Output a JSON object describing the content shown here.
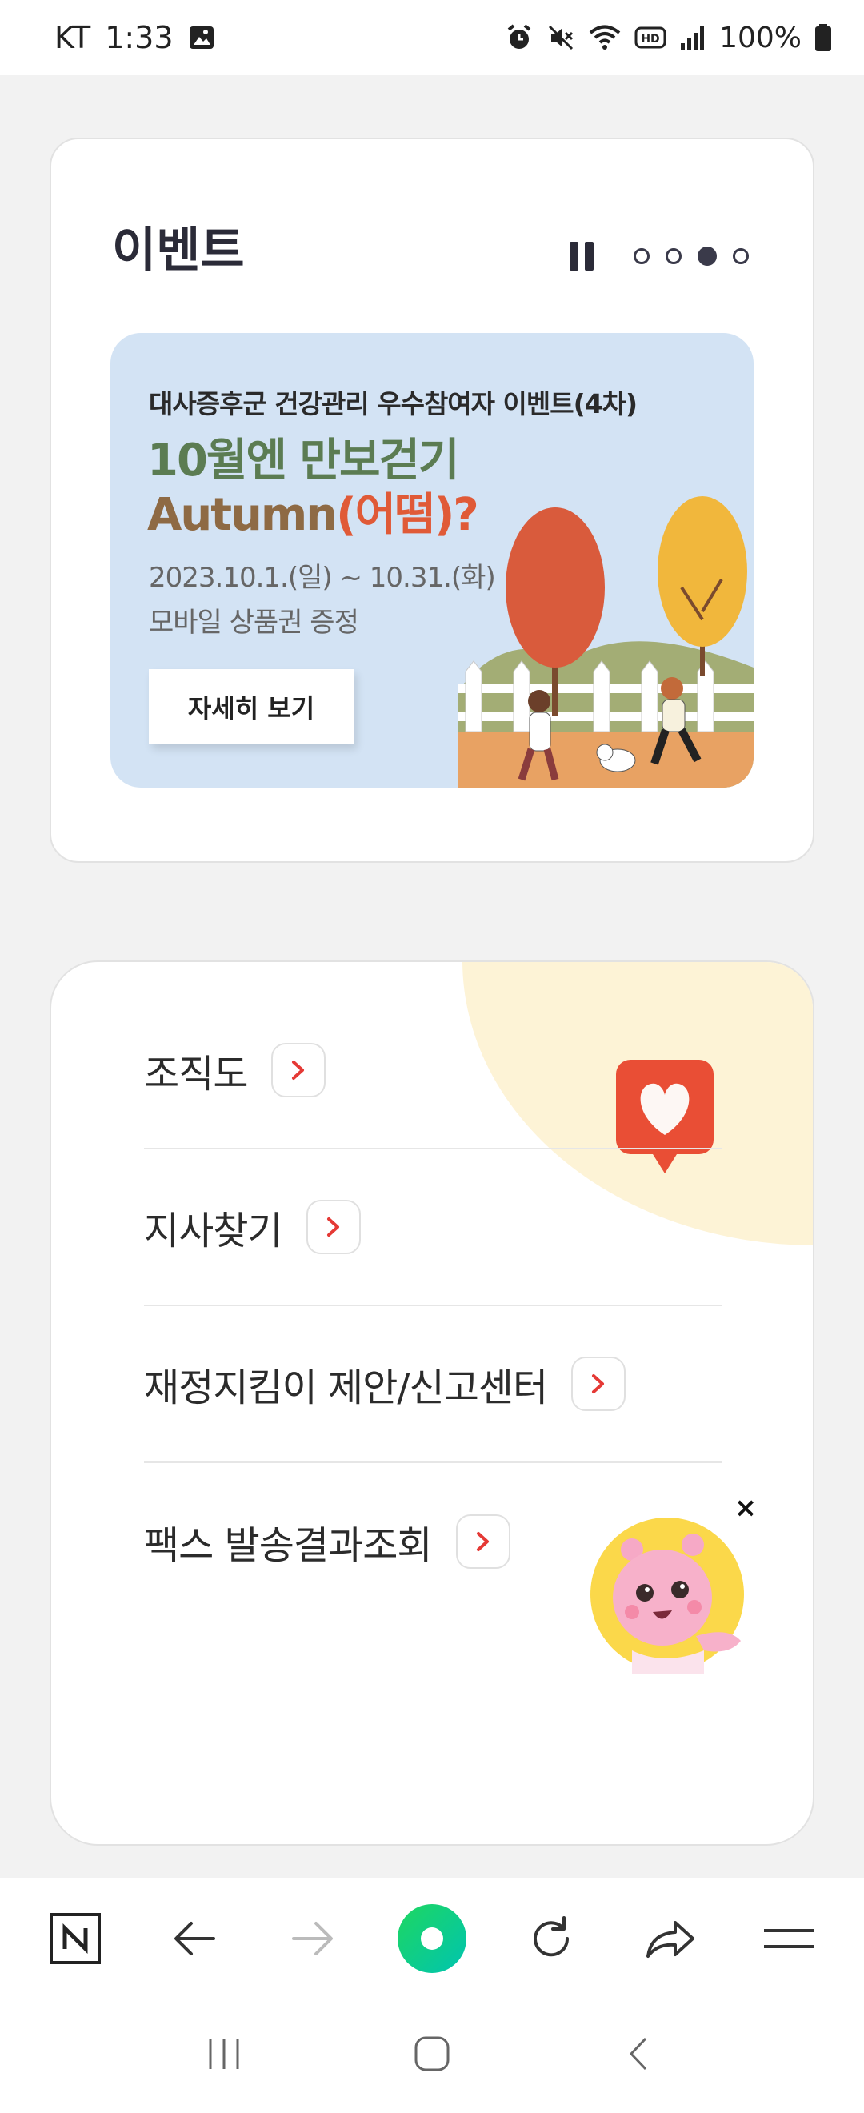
{
  "status_bar": {
    "carrier": "KT",
    "time": "1:33",
    "battery": "100%",
    "icons": [
      "image-icon",
      "alarm-icon",
      "mute-icon",
      "wifi-icon",
      "hd-icon",
      "signal-icon",
      "battery-icon"
    ]
  },
  "event": {
    "title": "이벤트",
    "carousel": {
      "total": 4,
      "active_index": 2
    },
    "banner": {
      "subtitle": "대사증후군 건강관리 우수참여자 이벤트(4차)",
      "headline": "10월엔 만보걷기",
      "headline2_a": "Autumn",
      "headline2_b": "(어떰)?",
      "date": "2023.10.1.(일) ~ 10.31.(화)",
      "gift": "모바일 상품권 증정",
      "button": "자세히 보기",
      "colors": {
        "bg": "#d3e3f4",
        "green": "#5b7c52",
        "brown": "#8e6a44",
        "orange": "#e05a37"
      }
    }
  },
  "menu": {
    "items": [
      {
        "label": "조직도"
      },
      {
        "label": "지사찾기"
      },
      {
        "label": "재정지킴이 제안/신고센터"
      },
      {
        "label": "팩스 발송결과조회"
      }
    ],
    "accent": "#e53935"
  },
  "mascot": {
    "close": "×"
  },
  "toolbar": {
    "icons": [
      "naver-n-icon",
      "back-arrow-icon",
      "forward-arrow-icon",
      "green-dot-icon",
      "refresh-icon",
      "share-icon",
      "menu-icon"
    ]
  },
  "nav": {
    "icons": [
      "recent-apps-icon",
      "home-icon",
      "back-icon"
    ]
  }
}
